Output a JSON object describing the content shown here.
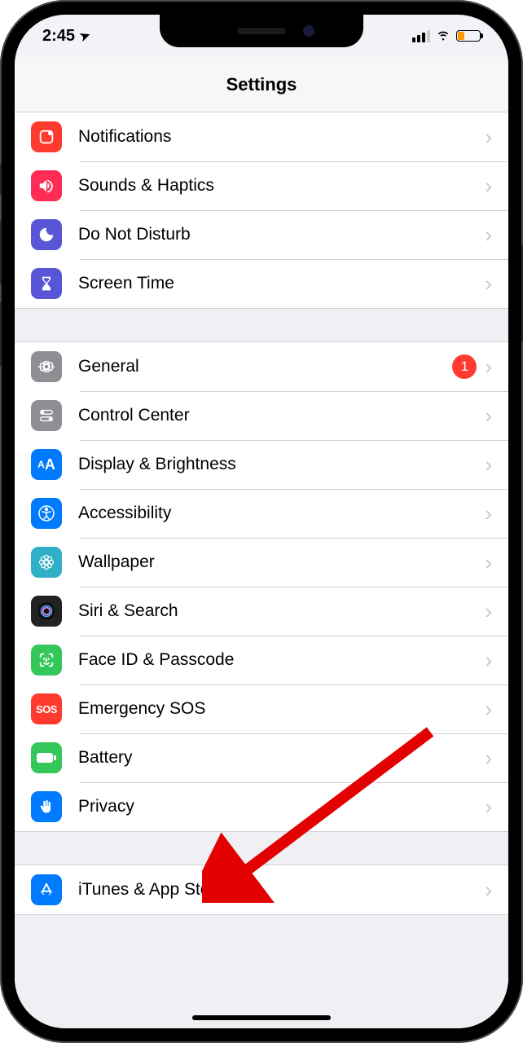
{
  "status": {
    "time": "2:45",
    "location_glyph": "➤"
  },
  "header": {
    "title": "Settings"
  },
  "groups": [
    [
      {
        "id": "notifications",
        "label": "Notifications",
        "bg": "#ff3b30"
      },
      {
        "id": "sounds",
        "label": "Sounds & Haptics",
        "bg": "#ff2d55"
      },
      {
        "id": "dnd",
        "label": "Do Not Disturb",
        "bg": "#5856d6"
      },
      {
        "id": "screentime",
        "label": "Screen Time",
        "bg": "#5856d6"
      }
    ],
    [
      {
        "id": "general",
        "label": "General",
        "bg": "#8e8e93",
        "badge": "1"
      },
      {
        "id": "controlcenter",
        "label": "Control Center",
        "bg": "#8e8e93"
      },
      {
        "id": "display",
        "label": "Display & Brightness",
        "bg": "#007aff"
      },
      {
        "id": "accessibility",
        "label": "Accessibility",
        "bg": "#007aff"
      },
      {
        "id": "wallpaper",
        "label": "Wallpaper",
        "bg": "#30b0c7"
      },
      {
        "id": "siri",
        "label": "Siri & Search",
        "bg": "#222"
      },
      {
        "id": "faceid",
        "label": "Face ID & Passcode",
        "bg": "#34c759"
      },
      {
        "id": "sos",
        "label": "Emergency SOS",
        "bg": "#ff3b30"
      },
      {
        "id": "battery",
        "label": "Battery",
        "bg": "#34c759"
      },
      {
        "id": "privacy",
        "label": "Privacy",
        "bg": "#007aff"
      }
    ],
    [
      {
        "id": "itunes",
        "label": "iTunes & App Store",
        "bg": "#007aff"
      }
    ]
  ]
}
